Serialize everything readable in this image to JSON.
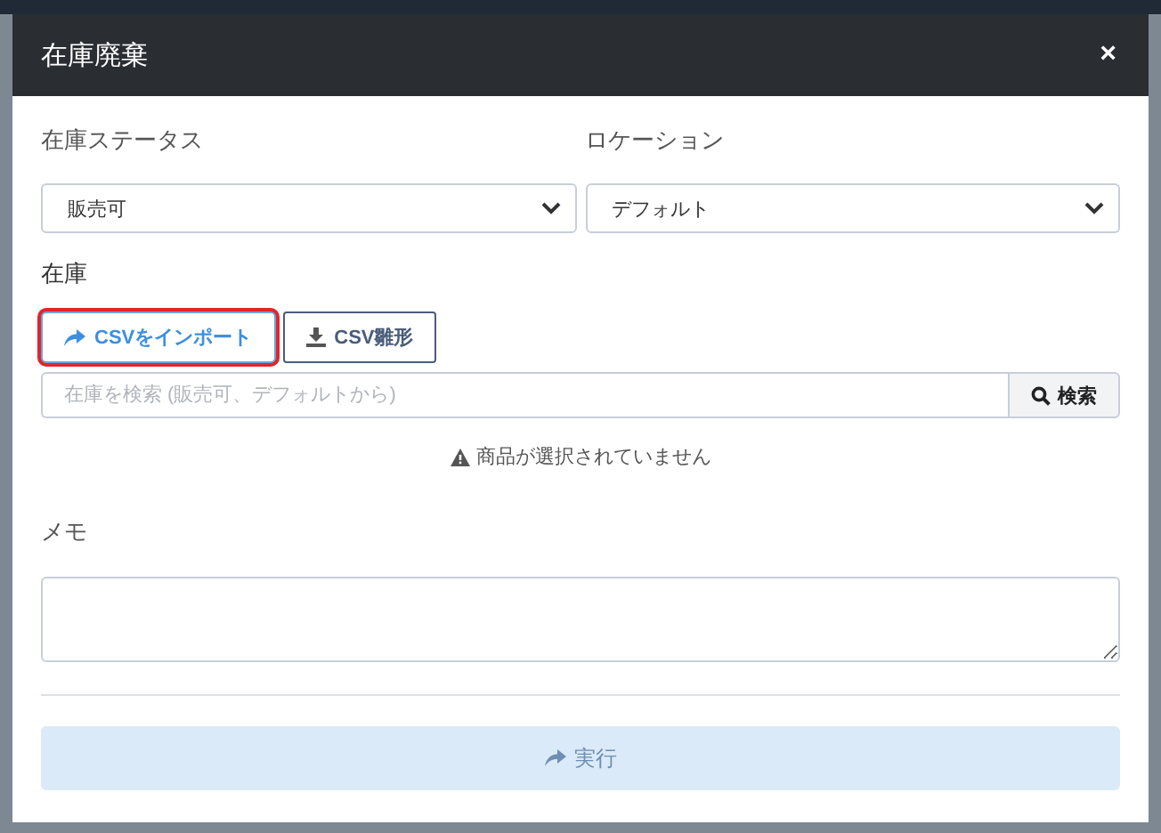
{
  "dialog": {
    "title": "在庫廃棄",
    "close": "×"
  },
  "filters": [
    {
      "label": "在庫ステータス",
      "value": "販売可"
    },
    {
      "label": "ロケーション",
      "value": "デフォルト"
    }
  ],
  "stock": {
    "label": "在庫",
    "buttons": [
      {
        "label": "CSVをインポート",
        "kind": "import",
        "highlighted": true
      },
      {
        "label": "CSV雛形",
        "kind": "download",
        "highlighted": false
      }
    ],
    "search": {
      "placeholder": "在庫を検索 (販売可、デフォルトから)",
      "button": "検索"
    },
    "warning": "商品が選択されていません"
  },
  "memo": {
    "label": "メモ"
  },
  "submit": {
    "label": "実行",
    "disabled": true
  }
}
